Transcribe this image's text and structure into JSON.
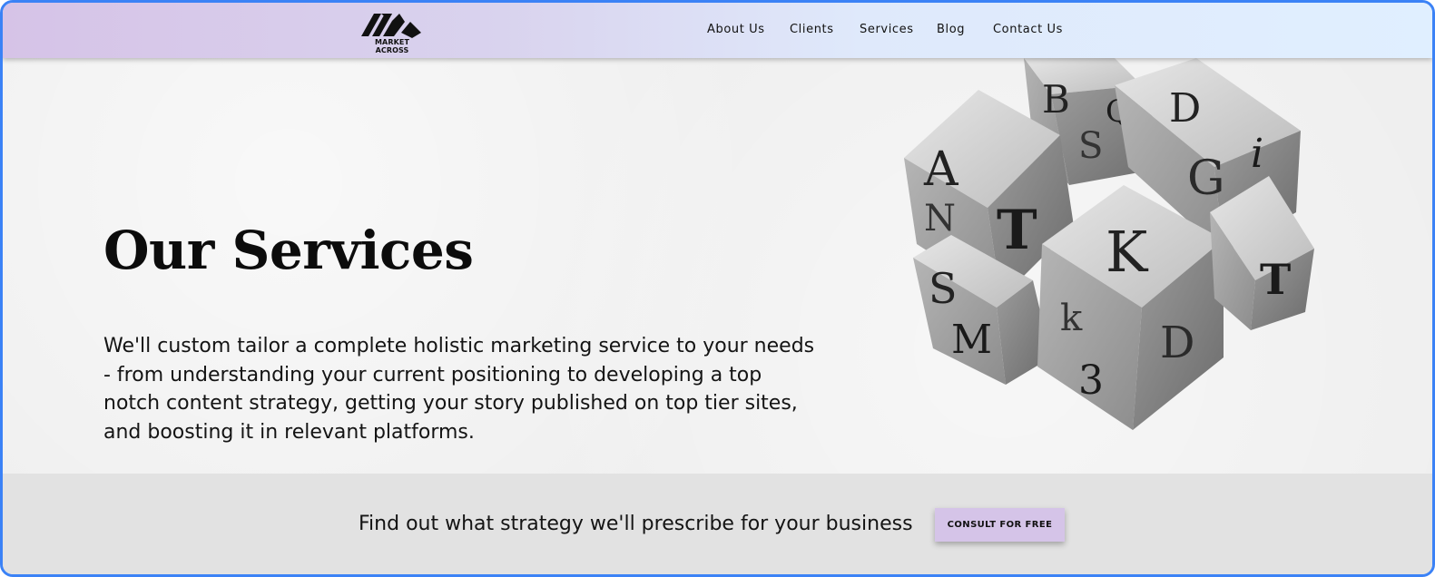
{
  "header": {
    "logo_text": "MARKET ACROSS",
    "nav": [
      {
        "label": "About Us"
      },
      {
        "label": "Clients"
      },
      {
        "label": "Services"
      },
      {
        "label": "Blog"
      },
      {
        "label": "Contact Us"
      }
    ]
  },
  "hero": {
    "title": "Our Services",
    "description": "We'll custom tailor a complete holistic marketing service to your needs - from understanding your current positioning to developing a top notch content strategy, getting your story published on top tier sites, and boosting it in relevant platforms.",
    "image": "typography-letter-cubes"
  },
  "cta": {
    "text": "Find out what strategy we'll prescribe for your business",
    "button_label": "CONSULT FOR FREE"
  },
  "colors": {
    "header_gradient_start": "#d6c3e7",
    "header_gradient_end": "#e0efff",
    "button_bg": "#d5c4e8",
    "cta_bg": "#e2e2e2",
    "hero_bg": "#efefef",
    "frame_border": "#3b82f6"
  }
}
